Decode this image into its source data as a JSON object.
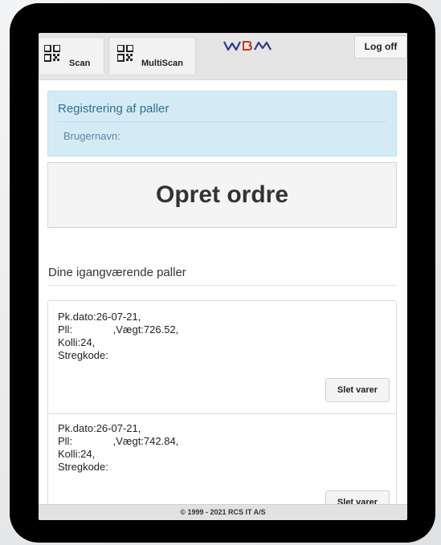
{
  "topbar": {
    "scan_label": "Scan",
    "multiscan_label": "MultiScan",
    "logo_text": "WBM",
    "logoff_label": "Log off"
  },
  "alert": {
    "heading": "Registrering af paller",
    "username_label": "Brugernavn:"
  },
  "create_order_label": "Opret ordre",
  "section_title": "Dine igangværende paller",
  "pallets": [
    {
      "line1": "Pk.dato:26-07-21,",
      "line2": "Pll:              ,Vægt:726.52,",
      "line3": "Kolli:24,",
      "line4": "Stregkode:",
      "delete_label": "Slet varer"
    },
    {
      "line1": "Pk.dato:26-07-21,",
      "line2": "Pll:              ,Vægt:742.84,",
      "line3": "Kolli:24,",
      "line4": "Stregkode:",
      "delete_label": "Slet varer"
    }
  ],
  "footer_text": "© 1999 - 2021 RCS IT A/S",
  "colors": {
    "alert_bg": "#d4ebf6",
    "alert_text": "#31708f",
    "device_frame": "#000000"
  },
  "icons": {
    "scan": "qr-code-icon",
    "multiscan": "qr-code-icon"
  }
}
